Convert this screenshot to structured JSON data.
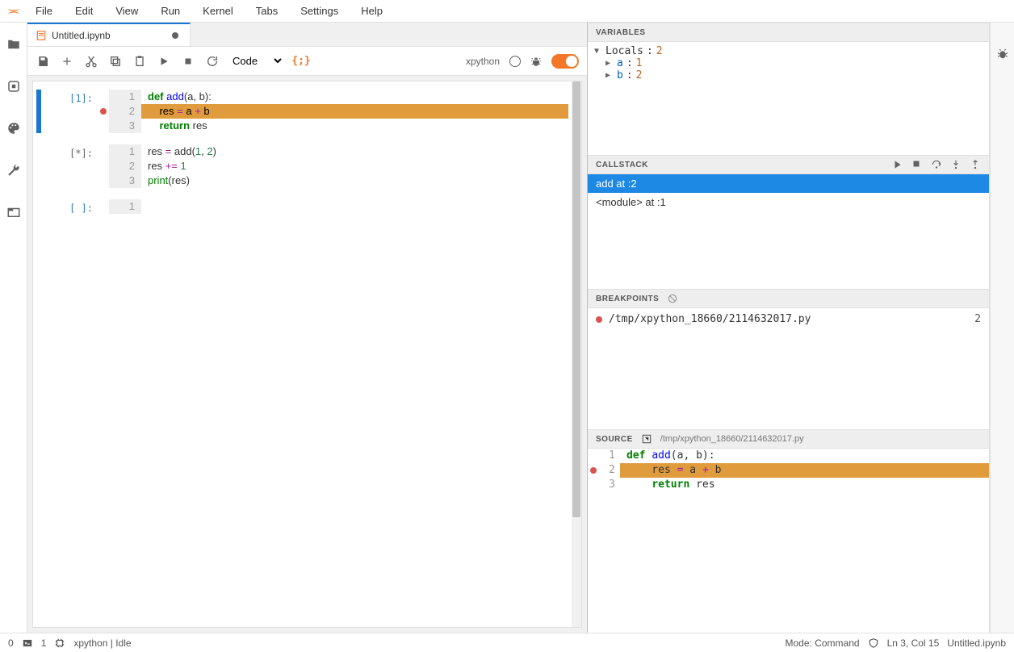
{
  "menubar": {
    "items": [
      "File",
      "Edit",
      "View",
      "Run",
      "Kernel",
      "Tabs",
      "Settings",
      "Help"
    ]
  },
  "tab": {
    "title": "Untitled.ipynb"
  },
  "toolbar": {
    "cell_type": "Code",
    "kernel": "xpython",
    "debug_brackets": "{;}"
  },
  "cells": [
    {
      "prompt": "[1]:",
      "active": true,
      "breakpoint_line": 2,
      "highlight_line": 2,
      "lines": [
        {
          "n": 1,
          "tokens": [
            [
              "kw",
              "def "
            ],
            [
              "fn",
              "add"
            ],
            [
              "",
              "(a, b):"
            ]
          ]
        },
        {
          "n": 2,
          "tokens": [
            [
              "",
              "    res "
            ],
            [
              "op",
              "="
            ],
            [
              "",
              " a "
            ],
            [
              "op",
              "+"
            ],
            [
              "",
              " b"
            ]
          ]
        },
        {
          "n": 3,
          "tokens": [
            [
              "",
              "    "
            ],
            [
              "kw",
              "return"
            ],
            [
              "",
              " res"
            ]
          ]
        }
      ]
    },
    {
      "prompt": "[*]:",
      "lines": [
        {
          "n": 1,
          "tokens": [
            [
              "",
              "res "
            ],
            [
              "op",
              "="
            ],
            [
              "",
              " add("
            ],
            [
              "num",
              "1"
            ],
            [
              "",
              ", "
            ],
            [
              "num",
              "2"
            ],
            [
              "",
              ")"
            ]
          ]
        },
        {
          "n": 2,
          "tokens": [
            [
              "",
              "res "
            ],
            [
              "op",
              "+="
            ],
            [
              "",
              " "
            ],
            [
              "num",
              "1"
            ]
          ]
        },
        {
          "n": 3,
          "tokens": [
            [
              "builtin",
              "print"
            ],
            [
              "",
              "(res)"
            ]
          ]
        }
      ]
    },
    {
      "prompt": "[ ]:",
      "lines": [
        {
          "n": 1,
          "tokens": [
            [
              "",
              ""
            ]
          ]
        }
      ]
    }
  ],
  "variables": {
    "title": "VARIABLES",
    "scope": "Locals",
    "scope_count": "2",
    "vars": [
      {
        "name": "a",
        "value": "1"
      },
      {
        "name": "b",
        "value": "2"
      }
    ]
  },
  "callstack": {
    "title": "CALLSTACK",
    "frames": [
      {
        "label": "add at :2",
        "selected": true
      },
      {
        "label": "<module> at :1",
        "selected": false
      }
    ]
  },
  "breakpoints": {
    "title": "BREAKPOINTS",
    "items": [
      {
        "file": "/tmp/xpython_18660/2114632017.py",
        "line": "2"
      }
    ]
  },
  "source": {
    "title": "SOURCE",
    "path": "/tmp/xpython_18660/2114632017.py",
    "breakpoint_line": 2,
    "highlight_line": 2,
    "lines": [
      {
        "n": 1,
        "tokens": [
          [
            "kw",
            "def "
          ],
          [
            "fn",
            "add"
          ],
          [
            "",
            "(a, b):"
          ]
        ]
      },
      {
        "n": 2,
        "tokens": [
          [
            "",
            "    res "
          ],
          [
            "op",
            "="
          ],
          [
            "",
            " a "
          ],
          [
            "op",
            "+"
          ],
          [
            "",
            " b"
          ]
        ]
      },
      {
        "n": 3,
        "tokens": [
          [
            "",
            "    "
          ],
          [
            "kw",
            "return"
          ],
          [
            "",
            " res"
          ]
        ]
      }
    ]
  },
  "statusbar": {
    "left_num0": "0",
    "left_num1": "1",
    "kernel_status": "xpython | Idle",
    "mode": "Mode: Command",
    "ln": "Ln 3, Col 15",
    "file": "Untitled.ipynb"
  }
}
